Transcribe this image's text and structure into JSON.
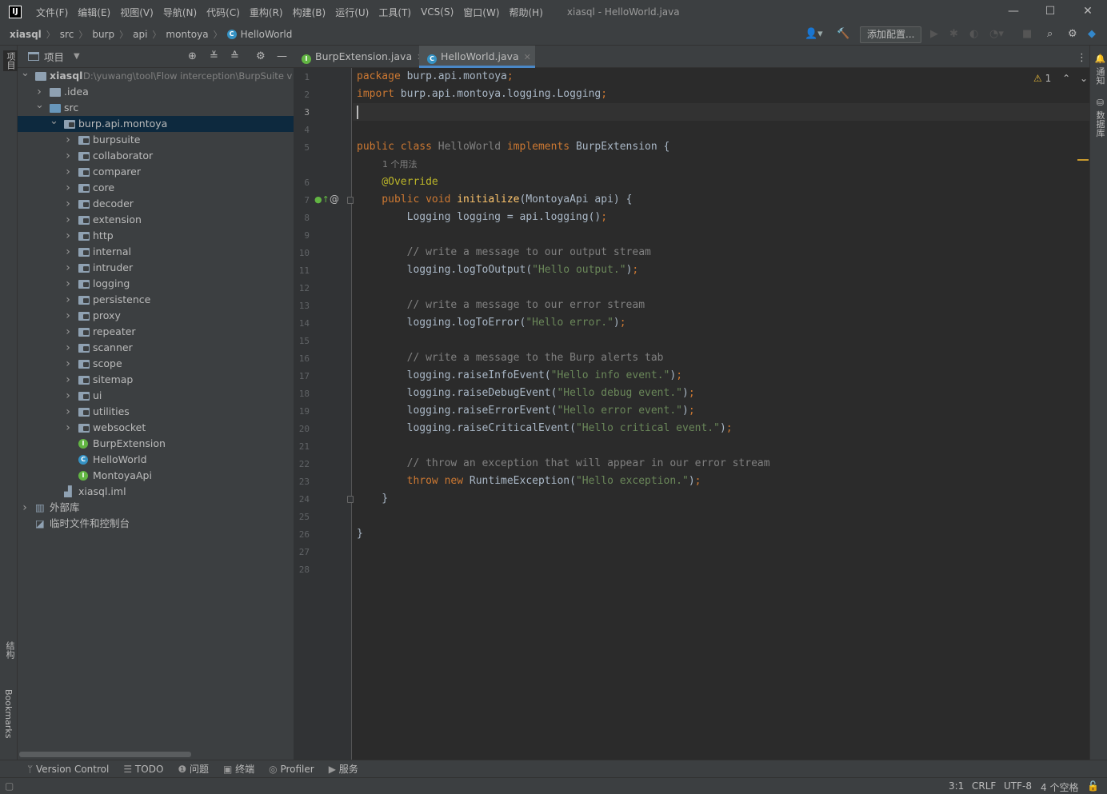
{
  "titlebar": {
    "logo": "IJ",
    "menu": [
      "文件(F)",
      "编辑(E)",
      "视图(V)",
      "导航(N)",
      "代码(C)",
      "重构(R)",
      "构建(B)",
      "运行(U)",
      "工具(T)",
      "VCS(S)",
      "窗口(W)",
      "帮助(H)"
    ],
    "window_title": "xiasql - HelloWorld.java",
    "controls": {
      "minimize": "—",
      "maximize": "☐",
      "close": "✕"
    }
  },
  "navbar": {
    "breadcrumbs": [
      "xiasql",
      "src",
      "burp",
      "api",
      "montoya",
      "HelloWorld"
    ],
    "run_config_label": "添加配置..."
  },
  "left_strip": {
    "top_tab": "项目",
    "structure_tab": "结构",
    "bookmarks_tab": "Bookmarks"
  },
  "right_strip": {
    "notifications_tab": "通知",
    "database_tab": "数据库"
  },
  "project_panel": {
    "title": "项目",
    "tree": [
      {
        "label": "xiasql",
        "path": "D:\\yuwang\\tool\\Flow interception\\BurpSuite v",
        "indent": 0,
        "chev": "v",
        "icon": "module"
      },
      {
        "label": ".idea",
        "indent": 1,
        "chev": ">",
        "icon": "folder"
      },
      {
        "label": "src",
        "indent": 1,
        "chev": "v",
        "icon": "folder-blue"
      },
      {
        "label": "burp.api.montoya",
        "indent": 2,
        "chev": "v",
        "icon": "package",
        "selected": true
      },
      {
        "label": "burpsuite",
        "indent": 3,
        "chev": ">",
        "icon": "package"
      },
      {
        "label": "collaborator",
        "indent": 3,
        "chev": ">",
        "icon": "package"
      },
      {
        "label": "comparer",
        "indent": 3,
        "chev": ">",
        "icon": "package"
      },
      {
        "label": "core",
        "indent": 3,
        "chev": ">",
        "icon": "package"
      },
      {
        "label": "decoder",
        "indent": 3,
        "chev": ">",
        "icon": "package"
      },
      {
        "label": "extension",
        "indent": 3,
        "chev": ">",
        "icon": "package"
      },
      {
        "label": "http",
        "indent": 3,
        "chev": ">",
        "icon": "package"
      },
      {
        "label": "internal",
        "indent": 3,
        "chev": ">",
        "icon": "package"
      },
      {
        "label": "intruder",
        "indent": 3,
        "chev": ">",
        "icon": "package"
      },
      {
        "label": "logging",
        "indent": 3,
        "chev": ">",
        "icon": "package"
      },
      {
        "label": "persistence",
        "indent": 3,
        "chev": ">",
        "icon": "package"
      },
      {
        "label": "proxy",
        "indent": 3,
        "chev": ">",
        "icon": "package"
      },
      {
        "label": "repeater",
        "indent": 3,
        "chev": ">",
        "icon": "package"
      },
      {
        "label": "scanner",
        "indent": 3,
        "chev": ">",
        "icon": "package"
      },
      {
        "label": "scope",
        "indent": 3,
        "chev": ">",
        "icon": "package"
      },
      {
        "label": "sitemap",
        "indent": 3,
        "chev": ">",
        "icon": "package"
      },
      {
        "label": "ui",
        "indent": 3,
        "chev": ">",
        "icon": "package"
      },
      {
        "label": "utilities",
        "indent": 3,
        "chev": ">",
        "icon": "package"
      },
      {
        "label": "websocket",
        "indent": 3,
        "chev": ">",
        "icon": "package"
      },
      {
        "label": "BurpExtension",
        "indent": 3,
        "chev": "",
        "icon": "interface"
      },
      {
        "label": "HelloWorld",
        "indent": 3,
        "chev": "",
        "icon": "class"
      },
      {
        "label": "MontoyaApi",
        "indent": 3,
        "chev": "",
        "icon": "interface"
      },
      {
        "label": "xiasql.iml",
        "indent": 2,
        "chev": "",
        "icon": "iml"
      },
      {
        "label": "外部库",
        "indent": 0,
        "chev": ">",
        "icon": "library"
      },
      {
        "label": "临时文件和控制台",
        "indent": 0,
        "chev": "",
        "icon": "scratch"
      }
    ]
  },
  "editor": {
    "tabs": [
      {
        "label": "BurpExtension.java",
        "icon": "interface",
        "active": false
      },
      {
        "label": "HelloWorld.java",
        "icon": "class",
        "active": true
      }
    ],
    "warning_count": "1",
    "usage_hint": "1 个用法",
    "current_line": 3,
    "lines": [
      [
        [
          "kw",
          "package "
        ],
        [
          "id",
          "burp.api.montoya"
        ],
        [
          "kw",
          ";"
        ]
      ],
      [
        [
          "kw",
          "import "
        ],
        [
          "id",
          "burp.api.montoya.logging.Logging"
        ],
        [
          "kw",
          ";"
        ]
      ],
      [],
      [],
      [
        [
          "kw",
          "public class "
        ],
        [
          "cm",
          "HelloWorld "
        ],
        [
          "kw",
          "implements "
        ],
        [
          "id",
          "BurpExtension {"
        ]
      ],
      [
        [
          "ann",
          "    @Override"
        ]
      ],
      [
        [
          "kw",
          "    public void "
        ],
        [
          "fn",
          "initialize"
        ],
        [
          "id",
          "(MontoyaApi api) {"
        ]
      ],
      [
        [
          "id",
          "        Logging logging = api.logging()"
        ],
        [
          "kw",
          ";"
        ]
      ],
      [],
      [
        [
          "cm",
          "        // write a message to our output stream"
        ]
      ],
      [
        [
          "id",
          "        logging.logToOutput("
        ],
        [
          "str",
          "\"Hello output.\""
        ],
        [
          "id",
          ")"
        ],
        [
          "kw",
          ";"
        ]
      ],
      [],
      [
        [
          "cm",
          "        // write a message to our error stream"
        ]
      ],
      [
        [
          "id",
          "        logging.logToError("
        ],
        [
          "str",
          "\"Hello error.\""
        ],
        [
          "id",
          ")"
        ],
        [
          "kw",
          ";"
        ]
      ],
      [],
      [
        [
          "cm",
          "        // write a message to the Burp alerts tab"
        ]
      ],
      [
        [
          "id",
          "        logging.raiseInfoEvent("
        ],
        [
          "str",
          "\"Hello info event.\""
        ],
        [
          "id",
          ")"
        ],
        [
          "kw",
          ";"
        ]
      ],
      [
        [
          "id",
          "        logging.raiseDebugEvent("
        ],
        [
          "str",
          "\"Hello debug event.\""
        ],
        [
          "id",
          ")"
        ],
        [
          "kw",
          ";"
        ]
      ],
      [
        [
          "id",
          "        logging.raiseErrorEvent("
        ],
        [
          "str",
          "\"Hello error event.\""
        ],
        [
          "id",
          ")"
        ],
        [
          "kw",
          ";"
        ]
      ],
      [
        [
          "id",
          "        logging.raiseCriticalEvent("
        ],
        [
          "str",
          "\"Hello critical event.\""
        ],
        [
          "id",
          ")"
        ],
        [
          "kw",
          ";"
        ]
      ],
      [],
      [
        [
          "cm",
          "        // throw an exception that will appear in our error stream"
        ]
      ],
      [
        [
          "kw",
          "        throw new "
        ],
        [
          "id",
          "RuntimeException("
        ],
        [
          "str",
          "\"Hello exception.\""
        ],
        [
          "id",
          ")"
        ],
        [
          "kw",
          ";"
        ]
      ],
      [
        [
          "id",
          "    }"
        ]
      ],
      [],
      [
        [
          "id",
          "}"
        ]
      ],
      [],
      []
    ]
  },
  "bottom_tools": [
    "Version Control",
    "TODO",
    "问题",
    "终端",
    "Profiler",
    "服务"
  ],
  "status": {
    "position": "3:1",
    "line_sep": "CRLF",
    "encoding": "UTF-8",
    "indent": "4 个空格"
  }
}
